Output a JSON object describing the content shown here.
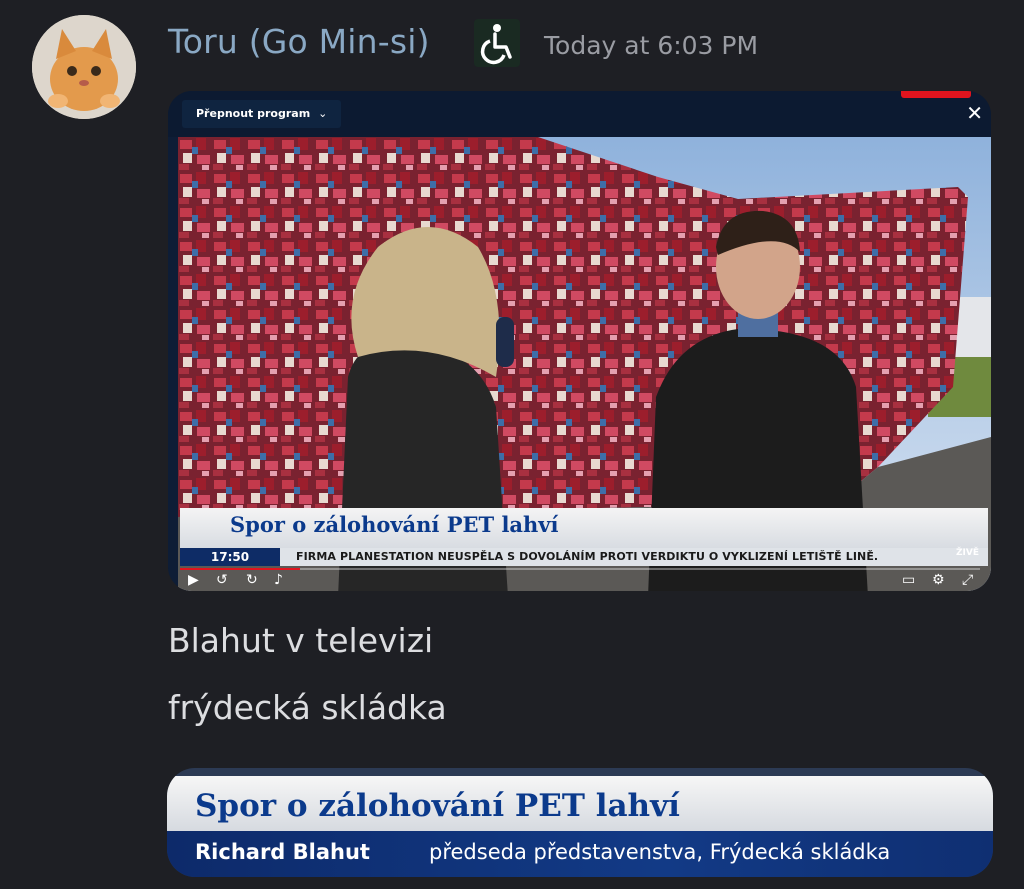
{
  "message": {
    "author": "Toru (Go Min-si)",
    "author_badge_icon": "wheelchair-icon",
    "timestamp": "Today at 6:03 PM",
    "lines": [
      "Blahut v televizi",
      "frýdecká skládka"
    ]
  },
  "video": {
    "program_button": "Přepnout program",
    "lower_third": {
      "headline": "Spor o zálohování PET lahví",
      "time": "17:50",
      "ticker": "FIRMA PLANESTATION NEUSPĚLA S DOVOLÁNÍM PROTI VERDIKTU O VYKLIZENÍ LETIŠTĚ LINĚ.",
      "live_label": "ŽIVĚ"
    },
    "controls": [
      "play-icon",
      "rewind-icon",
      "forward-icon",
      "volume-icon",
      "cast-icon",
      "settings-icon",
      "fullscreen-icon"
    ],
    "progress": 0.15,
    "colors": {
      "headline_blue": "#0b3a8c",
      "accent_red": "#e0141e"
    }
  },
  "name_card": {
    "headline": "Spor o zálohování PET lahví",
    "name": "Richard Blahut",
    "role": "předseda představenstva, Frýdecká skládka"
  }
}
